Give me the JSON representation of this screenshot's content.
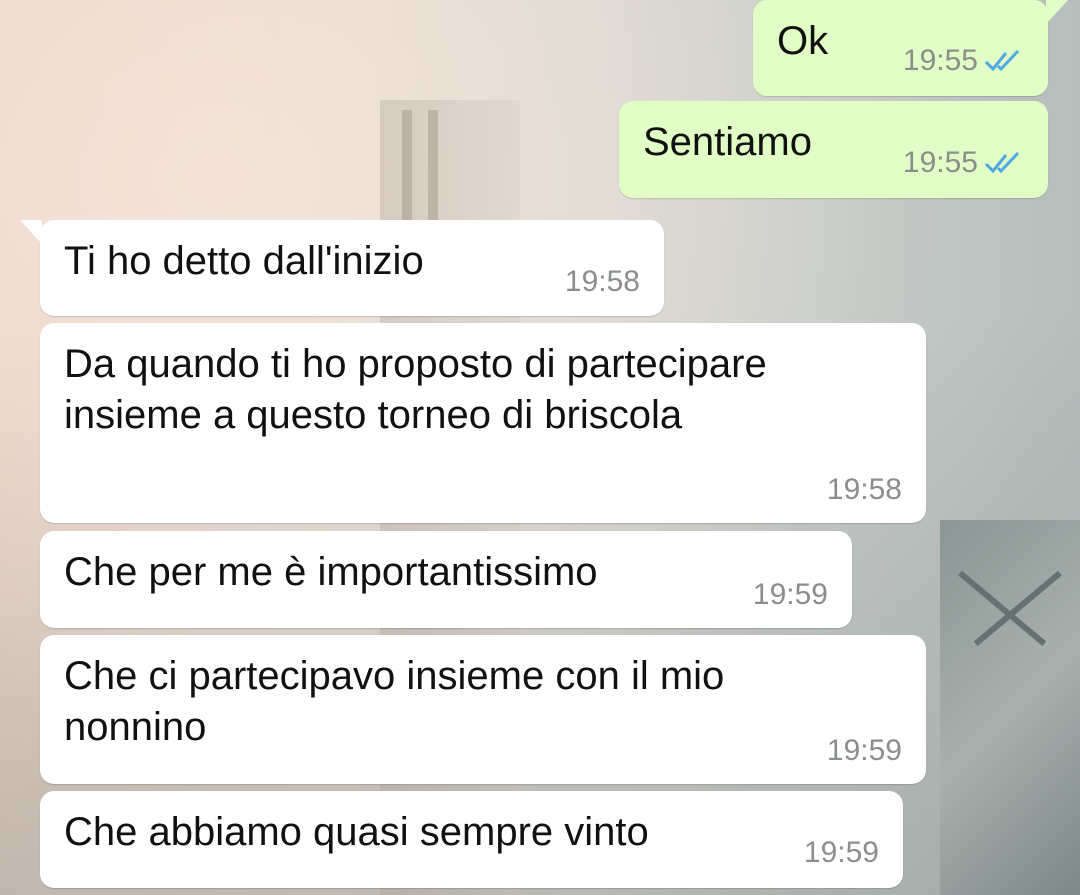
{
  "chat": {
    "messages": [
      {
        "text": "Ok",
        "time": "19:55",
        "direction": "outgoing",
        "status": "double-check-read-icon"
      },
      {
        "text": "Sentiamo",
        "time": "19:55",
        "direction": "outgoing",
        "status": "double-check-read-icon"
      },
      {
        "text": "Ti ho detto dall'inizio",
        "time": "19:58",
        "direction": "incoming"
      },
      {
        "text": "Da quando ti ho proposto di partecipare insieme a questo torneo di briscola",
        "time": "19:58",
        "direction": "incoming"
      },
      {
        "text": "Che per me è importantissimo",
        "time": "19:59",
        "direction": "incoming"
      },
      {
        "text": "Che ci partecipavo insieme con il mio nonnino",
        "time": "19:59",
        "direction": "incoming"
      },
      {
        "text": "Che abbiamo quasi sempre vinto",
        "time": "19:59",
        "direction": "incoming"
      }
    ]
  },
  "colors": {
    "outgoing_bubble": "#e1fec6",
    "incoming_bubble": "#ffffff",
    "read_ticks": "#4fa8e6",
    "timestamp": "#8b8f8c"
  }
}
